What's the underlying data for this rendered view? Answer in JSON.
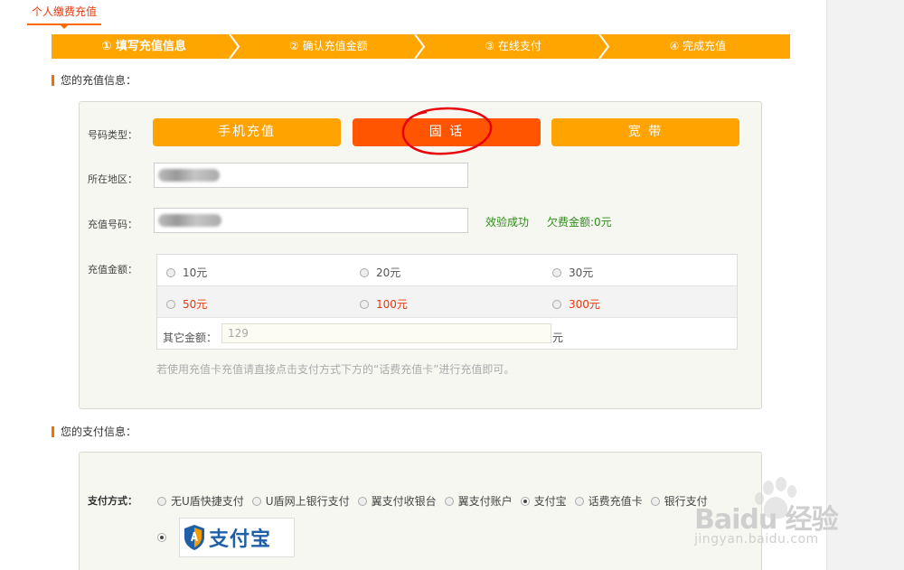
{
  "top_tab": {
    "label": "个人缴费充值"
  },
  "steps": [
    {
      "label": "① 填写充值信息"
    },
    {
      "label": "② 确认充值金额"
    },
    {
      "label": "③ 在线支付"
    },
    {
      "label": "④ 完成充值"
    }
  ],
  "recharge_section": {
    "title": "您的充值信息："
  },
  "number_type": {
    "label": "号码类型：",
    "options": [
      {
        "label": "手机充值"
      },
      {
        "label": "固 话"
      },
      {
        "label": "宽 带"
      }
    ],
    "selected": "固 话"
  },
  "region": {
    "label": "所在地区：",
    "value": ""
  },
  "phone": {
    "label": "充值号码：",
    "value": "",
    "verify_status": "效验成功",
    "arrears": "欠费金额:0元"
  },
  "amount": {
    "label": "充值金额：",
    "row1": [
      "10元",
      "20元",
      "30元"
    ],
    "row2": [
      "50元",
      "100元",
      "300元"
    ],
    "other_label": "其它金额：",
    "other_placeholder": "129",
    "other_unit": "元"
  },
  "hint": "若使用充值卡充值请直接点击支付方式下方的“话费充值卡”进行充值即可。",
  "payment_section": {
    "title": "您的支付信息："
  },
  "payment": {
    "label": "支付方式：",
    "options": [
      "无U盾快捷支付",
      "U盾网上银行支付",
      "翼支付收银台",
      "翼支付账户",
      "支付宝",
      "话费充值卡",
      "银行支付"
    ],
    "selected": "支付宝",
    "logo_text": "支付宝"
  },
  "colors": {
    "accent": "#ff6a00",
    "step_bg": "#ffa500",
    "selected_btn": "#ff5500",
    "ok": "#2c8d17"
  }
}
